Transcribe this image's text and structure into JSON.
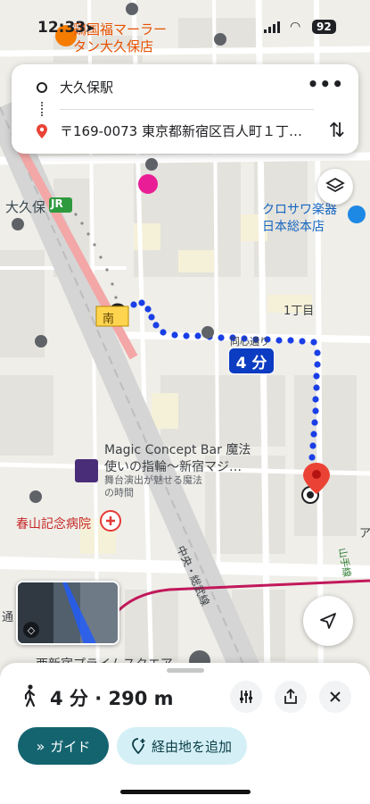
{
  "status_bar": {
    "time": "12:33",
    "battery": "92"
  },
  "route": {
    "origin": "大久保駅",
    "destination": "〒169-0073 東京都新宿区百人町１丁…"
  },
  "map": {
    "places": {
      "restaurant": "鶏国福マーラー\nタン大久保店",
      "okubo": "大久保",
      "jr": "JR",
      "south_exit": "南",
      "musical": "クロサワ楽器\n日本総本店",
      "chome": "1丁目",
      "street": "同心通り",
      "bar": "Magic Concept Bar 魔法\n使いの指輪～新宿マジ…",
      "bar_sub": "舞台演出が魅せる魔法\nの時間",
      "hospital": "春山記念病院",
      "line": "中央・総武線",
      "yamanote": "山手線",
      "square": "西新宿プライムスクエア",
      "edge_left": "通",
      "edge_right": "ア"
    },
    "route_time": "4 分"
  },
  "sheet": {
    "summary": "4 分 · 290 m",
    "guide_label": "ガイド",
    "add_stop_label": "経由地を追加"
  },
  "colors": {
    "route": "#1a3fe6",
    "guide": "#146470",
    "badge": "#0b3cc1",
    "pin": "#ea4335"
  }
}
